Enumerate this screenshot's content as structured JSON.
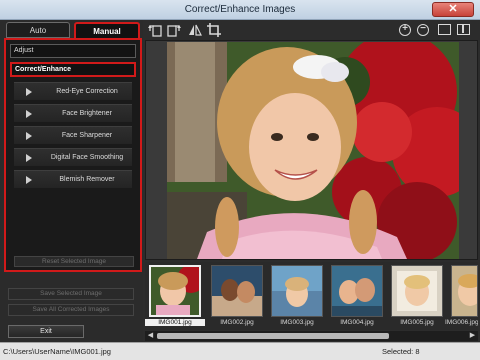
{
  "window": {
    "title": "Correct/Enhance Images",
    "close_glyph": "✕"
  },
  "tabs": [
    {
      "label": "Auto"
    },
    {
      "label": "Manual"
    }
  ],
  "panel": {
    "adjust_label": "Adjust",
    "correct_enhance_label": "Correct/Enhance",
    "tools": [
      {
        "label": "Red-Eye Correction"
      },
      {
        "label": "Face Brightener"
      },
      {
        "label": "Face Sharpener"
      },
      {
        "label": "Digital Face Smoothing"
      },
      {
        "label": "Blemish Remover"
      }
    ],
    "reset_label": "Reset Selected Image"
  },
  "actions": {
    "save_selected": "Save Selected Image",
    "save_all": "Save All Corrected Images",
    "exit": "Exit"
  },
  "toolbar": {
    "icons": [
      "rotate-left-icon",
      "rotate-right-icon",
      "flip-icon",
      "crop-icon",
      "zoom-in-icon",
      "zoom-out-icon",
      "single-view-icon",
      "compare-view-icon"
    ],
    "zoom_in_glyph": "+",
    "zoom_out_glyph": "−"
  },
  "filmstrip": {
    "thumbnails": [
      {
        "name": "IMG001.jpg",
        "selected": true
      },
      {
        "name": "IMG002.jpg",
        "selected": false
      },
      {
        "name": "IMG003.jpg",
        "selected": false
      },
      {
        "name": "IMG004.jpg",
        "selected": false
      },
      {
        "name": "IMG005.jpg",
        "selected": false
      },
      {
        "name": "IMG006.jpg",
        "selected": false
      }
    ],
    "scroll_left_glyph": "◀",
    "scroll_right_glyph": "▶"
  },
  "status": {
    "path": "C:\\Users\\UserName\\IMG001.jpg",
    "selected": "Selected: 8"
  },
  "colors": {
    "highlight": "#d11a1a",
    "background": "#2c2c2c"
  }
}
